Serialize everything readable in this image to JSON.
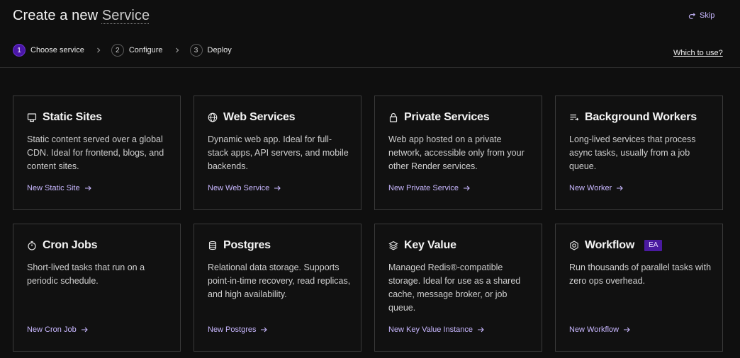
{
  "header": {
    "title_prefix": "Create a new",
    "title_accent": "Service",
    "skip_label": "Skip",
    "which_label": "Which to use?"
  },
  "steps": [
    {
      "num": "1",
      "label": "Choose service",
      "active": true
    },
    {
      "num": "2",
      "label": "Configure",
      "active": false
    },
    {
      "num": "3",
      "label": "Deploy",
      "active": false
    }
  ],
  "cards": [
    {
      "icon": "static-site-icon",
      "title": "Static Sites",
      "desc": "Static content served over a global CDN. Ideal for frontend, blogs, and content sites.",
      "link": "New Static Site"
    },
    {
      "icon": "globe-icon",
      "title": "Web Services",
      "desc": "Dynamic web app. Ideal for full-stack apps, API servers, and mobile backends.",
      "link": "New Web Service"
    },
    {
      "icon": "lock-icon",
      "title": "Private Services",
      "desc": "Web app hosted on a private network, accessible only from your other Render services.",
      "link": "New Private Service"
    },
    {
      "icon": "list-arrow-icon",
      "title": "Background Workers",
      "desc": "Long-lived services that process async tasks, usually from a job queue.",
      "link": "New Worker"
    },
    {
      "icon": "stopwatch-icon",
      "title": "Cron Jobs",
      "desc": "Short-lived tasks that run on a periodic schedule.",
      "link": "New Cron Job"
    },
    {
      "icon": "database-icon",
      "title": "Postgres",
      "desc": "Relational data storage. Supports point-in-time recovery, read replicas, and high availability.",
      "link": "New Postgres"
    },
    {
      "icon": "layers-icon",
      "title": "Key Value",
      "desc": "Managed Redis®-compatible storage. Ideal for use as a shared cache, message broker, or job queue.",
      "link": "New Key Value Instance"
    },
    {
      "icon": "workflow-icon",
      "title": "Workflow",
      "badge": "EA",
      "desc": "Run thousands of parallel tasks with zero ops overhead.",
      "link": "New Workflow"
    }
  ],
  "colors": {
    "background": "#0f0f0f",
    "accent": "#c8b7ff",
    "active_step": "#4a16a8",
    "badge": "#4a1aa0"
  }
}
